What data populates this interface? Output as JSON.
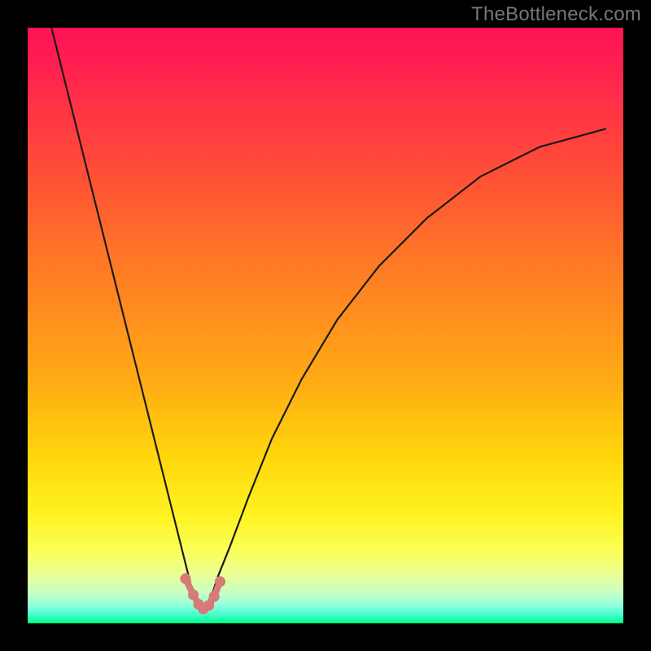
{
  "watermark": "TheBottleneck.com",
  "colors": {
    "curve": "#1a1a1a",
    "marker": "#d77a78",
    "frame": "#000000"
  },
  "chart_data": {
    "type": "line",
    "title": "",
    "xlabel": "",
    "ylabel": "",
    "xlim": [
      0,
      100
    ],
    "ylim": [
      0,
      100
    ],
    "note": "No axes, ticks, or numeric labels are rendered in the source image. Values below are estimated from pixel positions on a normalized 0–100 grid (origin bottom-left). The curve appears to be a V-shaped bottleneck profile with its minimum near x≈29.",
    "series": [
      {
        "name": "bottleneck-curve",
        "x": [
          4,
          8,
          12,
          16,
          20,
          24,
          26,
          27,
          28,
          29,
          30,
          31,
          32,
          34,
          37,
          41,
          46,
          52,
          59,
          67,
          76,
          86,
          97
        ],
        "values": [
          100,
          84,
          68,
          52,
          36,
          20,
          12,
          8,
          4,
          2,
          3,
          5,
          8,
          13,
          21,
          31,
          41,
          51,
          60,
          68,
          75,
          80,
          83
        ]
      }
    ],
    "markers": {
      "name": "min-region-dots",
      "x": [
        26.5,
        27.8,
        28.7,
        29.5,
        30.4,
        31.3,
        32.3
      ],
      "values": [
        7.5,
        4.8,
        3.2,
        2.4,
        3.0,
        4.5,
        7.0
      ]
    }
  }
}
